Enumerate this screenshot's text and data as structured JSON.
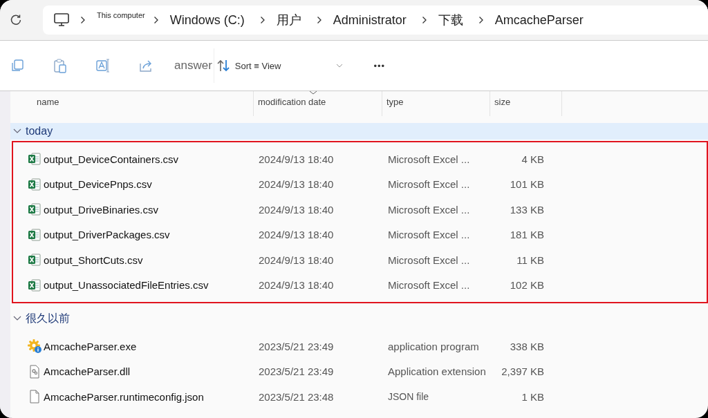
{
  "address_bar": {
    "crumbs": [
      {
        "label": "This computer",
        "kind": "small"
      },
      {
        "label": "Windows (C:)",
        "kind": "normal"
      },
      {
        "label": "用户",
        "kind": "normal"
      },
      {
        "label": "Administrator",
        "kind": "normal"
      },
      {
        "label": "下载",
        "kind": "normal"
      },
      {
        "label": "AmcacheParser",
        "kind": "normal"
      }
    ]
  },
  "toolbar": {
    "label": "answer",
    "sort_view": "Sort ≡ View",
    "more": "•••"
  },
  "columns": [
    {
      "label": "name",
      "sorted": false
    },
    {
      "label": "modification date",
      "sorted": true
    },
    {
      "label": "type",
      "sorted": false
    },
    {
      "label": "size",
      "sorted": false
    }
  ],
  "groups": [
    {
      "label": "today",
      "expanded": true,
      "selected": true,
      "highlighted": true,
      "files": [
        {
          "kind": "excel",
          "name": "output_DeviceContainers.csv",
          "date": "2024/9/13 18:40",
          "type": "Microsoft Excel ...",
          "size": "4 KB"
        },
        {
          "kind": "excel",
          "name": "output_DevicePnps.csv",
          "date": "2024/9/13 18:40",
          "type": "Microsoft Excel ...",
          "size": "101 KB"
        },
        {
          "kind": "excel",
          "name": "output_DriveBinaries.csv",
          "date": "2024/9/13 18:40",
          "type": "Microsoft Excel ...",
          "size": "133 KB"
        },
        {
          "kind": "excel",
          "name": "output_DriverPackages.csv",
          "date": "2024/9/13 18:40",
          "type": "Microsoft Excel ...",
          "size": "181 KB"
        },
        {
          "kind": "excel",
          "name": "output_ShortCuts.csv",
          "date": "2024/9/13 18:40",
          "type": "Microsoft Excel ...",
          "size": "11 KB"
        },
        {
          "kind": "excel",
          "name": "output_UnassociatedFileEntries.csv",
          "date": "2024/9/13 18:40",
          "type": "Microsoft Excel ...",
          "size": "102 KB"
        }
      ]
    },
    {
      "label": "很久以前",
      "expanded": true,
      "selected": false,
      "highlighted": false,
      "files": [
        {
          "kind": "exe",
          "name": "AmcacheParser.exe",
          "date": "2023/5/21 23:49",
          "type": "application program",
          "size": "338 KB"
        },
        {
          "kind": "dll",
          "name": "AmcacheParser.dll",
          "date": "2023/5/21 23:49",
          "type": "Application extension",
          "size": "2,397 KB"
        },
        {
          "kind": "file",
          "name": "AmcacheParser.runtimeconfig.json",
          "date": "2023/5/21 23:48",
          "type": "JSON file",
          "size": "1 KB"
        }
      ]
    }
  ]
}
